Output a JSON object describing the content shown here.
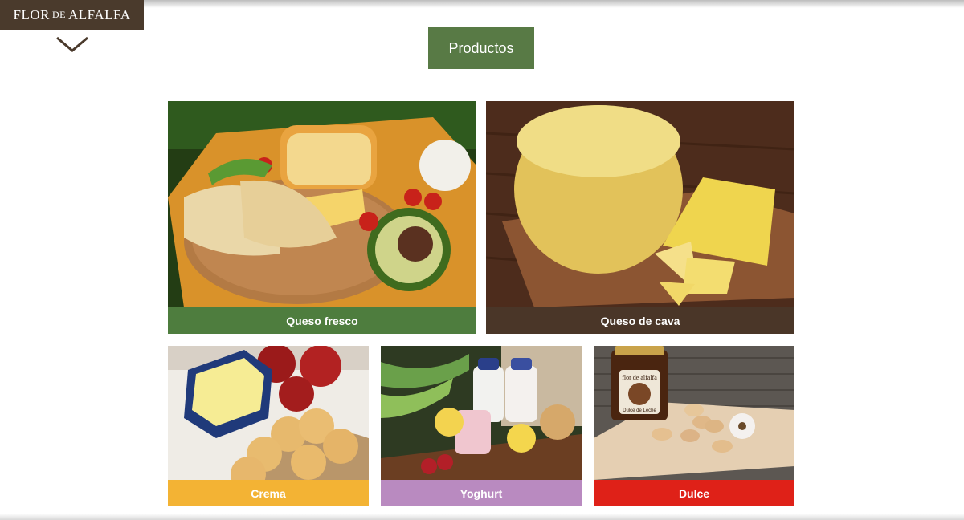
{
  "brand": {
    "logo_main": "FLOR",
    "logo_small": "DE",
    "logo_end": "ALFALFA"
  },
  "header": {
    "title": "Productos"
  },
  "colors": {
    "brand_brown": "#4a3a2c",
    "title_green": "#587a45",
    "fresco": "#4e7d3e",
    "cava": "#4a3628",
    "crema": "#f3b334",
    "yoghurt": "#b98ac0",
    "dulce": "#df2118"
  },
  "products": [
    {
      "label": "Queso fresco",
      "color": "#4e7d3e"
    },
    {
      "label": "Queso de cava",
      "color": "#4a3628"
    },
    {
      "label": "Crema",
      "color": "#f3b334"
    },
    {
      "label": "Yoghurt",
      "color": "#b98ac0"
    },
    {
      "label": "Dulce",
      "color": "#df2118"
    }
  ],
  "jar_text": {
    "line1": "flor de alfalfa",
    "line2": "Dulce de Leche"
  }
}
